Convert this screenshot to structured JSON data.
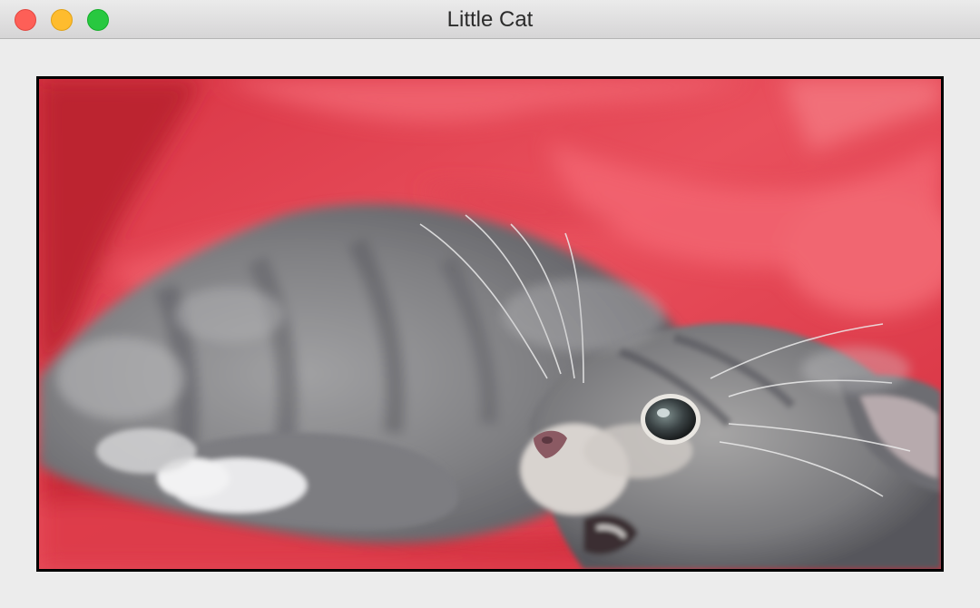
{
  "window": {
    "title": "Little Cat",
    "controls": {
      "close": "close-icon",
      "minimize": "minimize-icon",
      "zoom": "zoom-icon"
    },
    "colors": {
      "close": "#fe5f57",
      "minimize": "#febc2e",
      "zoom": "#28c840",
      "background": "#ececec"
    }
  },
  "image": {
    "subject": "grey-kitten-on-red-blanket",
    "colors": {
      "blanket": "#e6454f",
      "fur": "#8a8a8c",
      "frame": "#000000"
    }
  }
}
